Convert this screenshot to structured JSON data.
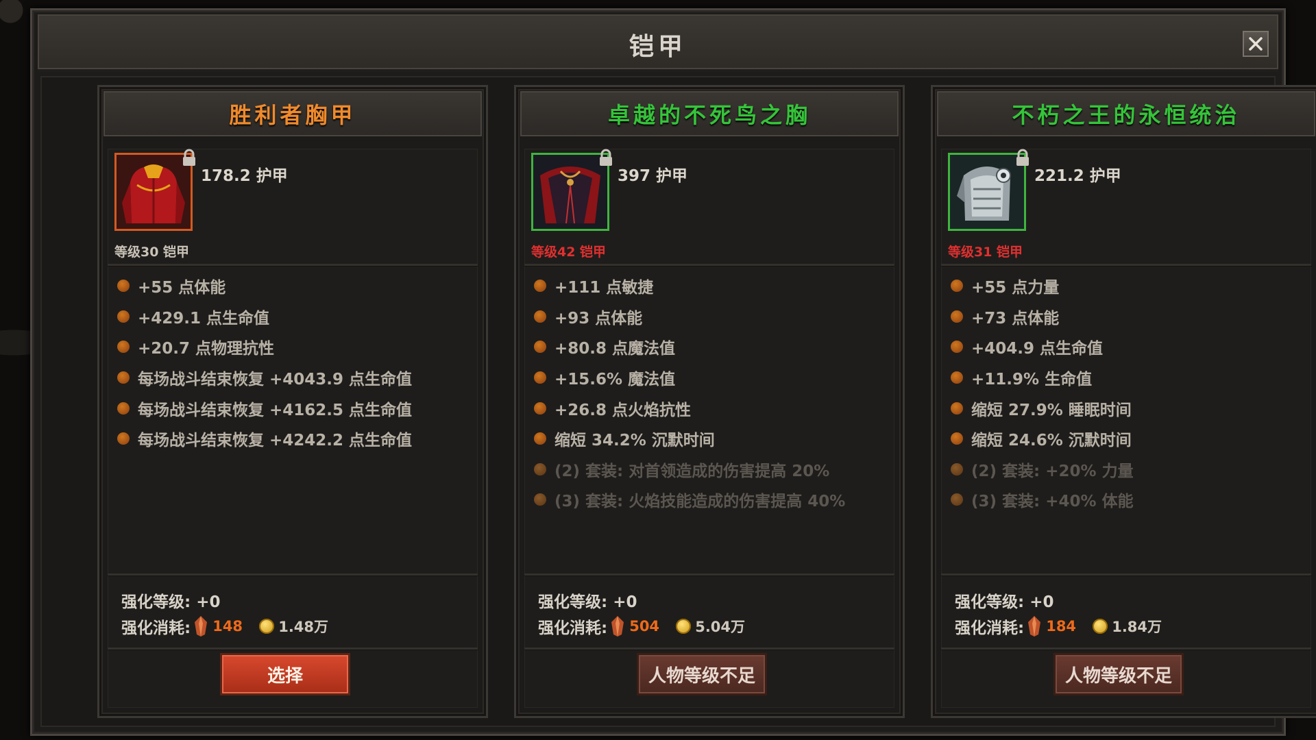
{
  "window": {
    "title": "铠甲"
  },
  "colors": {
    "orange_title": "#f08a2c",
    "green_title": "#35c43a",
    "requirement_red": "#e03030"
  },
  "panels": [
    {
      "name": "胜利者胸甲",
      "name_color": "#f08a2c",
      "icon": "red-chest-armor-icon",
      "armor": "178.2 护甲",
      "requirement": "等级30  铠甲",
      "requirement_met": true,
      "stats": [
        "+55 点体能",
        "+429.1 点生命值",
        "+20.7 点物理抗性",
        "每场战斗结束恢复 +4043.9 点生命值",
        "每场战斗结束恢复 +4162.5 点生命值",
        "每场战斗结束恢复 +4242.2 点生命值"
      ],
      "set_bonuses": [],
      "enhance_level_label": "强化等级:  +0",
      "enhance_cost_label": "强化消耗:",
      "crystal_cost": "148",
      "gold_cost": "1.48万",
      "button_label": "选择",
      "button_enabled": true
    },
    {
      "name": "卓越的不死鸟之胸",
      "name_color": "#35c43a",
      "icon": "phoenix-cloak-icon",
      "armor": "397 护甲",
      "requirement": "等级42  铠甲",
      "requirement_met": false,
      "stats": [
        "+111 点敏捷",
        "+93 点体能",
        "+80.8 点魔法值",
        "+15.6% 魔法值",
        "+26.8 点火焰抗性",
        "缩短 34.2% 沉默时间"
      ],
      "set_bonuses": [
        "(2) 套装: 对首领造成的伤害提高 20%",
        "(3) 套装: 火焰技能造成的伤害提高 40%"
      ],
      "enhance_level_label": "强化等级:  +0",
      "enhance_cost_label": "强化消耗:",
      "crystal_cost": "504",
      "gold_cost": "5.04万",
      "button_label": "人物等级不足",
      "button_enabled": false
    },
    {
      "name": "不朽之王的永恒统治",
      "name_color": "#35c43a",
      "icon": "steel-plate-armor-icon",
      "armor": "221.2 护甲",
      "requirement": "等级31  铠甲",
      "requirement_met": false,
      "stats": [
        "+55 点力量",
        "+73 点体能",
        "+404.9 点生命值",
        "+11.9% 生命值",
        "缩短 27.9% 睡眠时间",
        "缩短 24.6% 沉默时间"
      ],
      "set_bonuses": [
        "(2) 套装: +20% 力量",
        "(3) 套装: +40% 体能"
      ],
      "enhance_level_label": "强化等级:  +0",
      "enhance_cost_label": "强化消耗:",
      "crystal_cost": "184",
      "gold_cost": "1.84万",
      "button_label": "人物等级不足",
      "button_enabled": false
    }
  ]
}
